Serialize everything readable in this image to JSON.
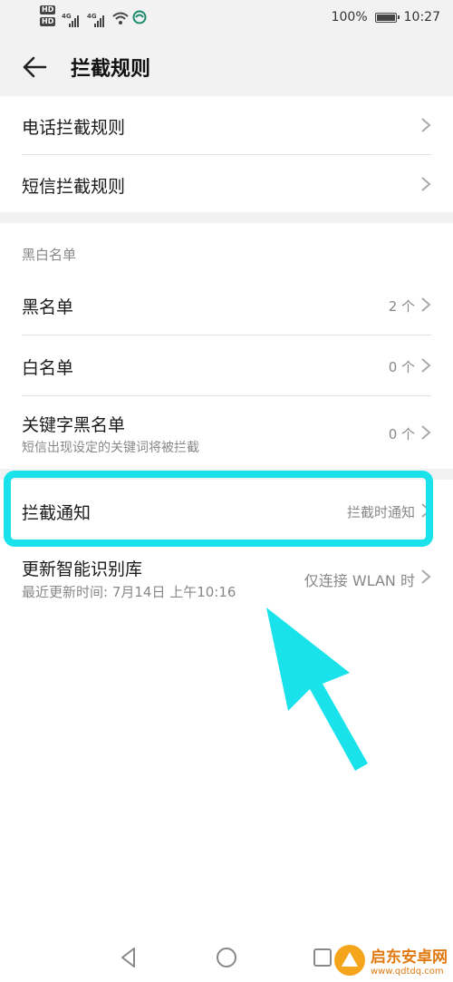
{
  "status_bar": {
    "hd_badge_1": "HD",
    "hd_badge_2": "HD",
    "net_1": "4G",
    "net_2": "4G",
    "battery": "100%",
    "time": "10:27"
  },
  "app_bar": {
    "title": "拦截规则"
  },
  "rules": [
    {
      "label": "电话拦截规则"
    },
    {
      "label": "短信拦截规则"
    }
  ],
  "blacklist_section": {
    "title": "黑白名单",
    "items": [
      {
        "label": "黑名单",
        "value": "2 个"
      },
      {
        "label": "白名单",
        "value": "0 个"
      },
      {
        "label": "关键字黑名单",
        "sub": "短信出现设定的关键词将被拦截",
        "value": "0 个"
      }
    ]
  },
  "notify": {
    "label": "拦截通知",
    "value": "拦截时通知"
  },
  "update": {
    "label": "更新智能识别库",
    "sub": "最近更新时间: 7月14日 上午10:16",
    "value": "仅连接 WLAN 时"
  },
  "watermark": {
    "title": "启东安卓网",
    "url": "www.qdtdq.com"
  },
  "colors": {
    "highlight": "#19e2ea",
    "background": "#f2f2f2",
    "secondary_text": "#888888"
  }
}
